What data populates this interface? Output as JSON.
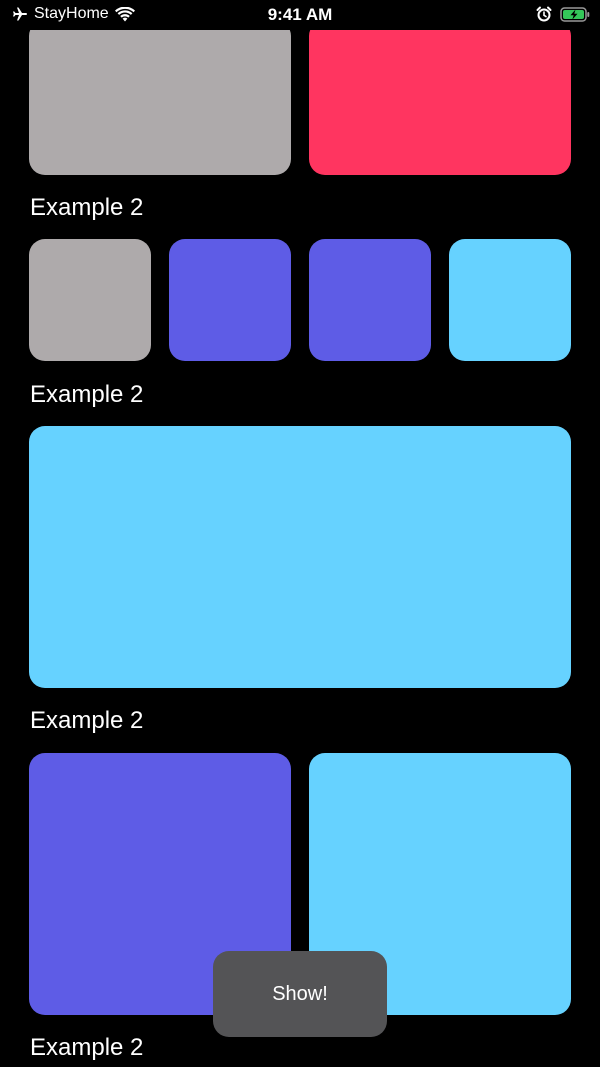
{
  "status_bar": {
    "carrier": "StayHome",
    "time": "9:41 AM",
    "icons": [
      "airplane-icon",
      "wifi-icon",
      "alarm-icon",
      "battery-charging-icon"
    ]
  },
  "sections": [
    {
      "label": "Example 2"
    },
    {
      "label": "Example 2"
    },
    {
      "label": "Example 2"
    },
    {
      "label": "Example 2"
    }
  ],
  "tile_colors": {
    "gray": "#aeaaab",
    "pink": "#ff3560",
    "indigo": "#5e5ce6",
    "cyan": "#66d2ff"
  },
  "toast": {
    "label": "Show!"
  }
}
